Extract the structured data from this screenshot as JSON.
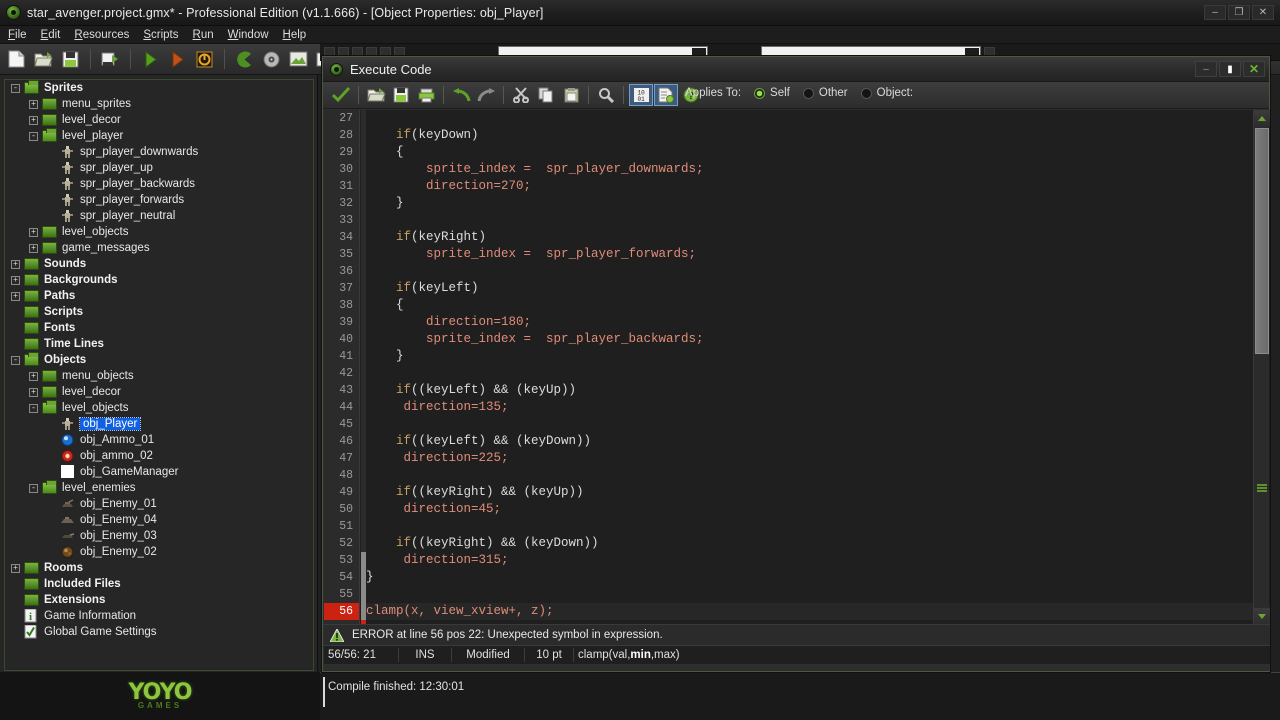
{
  "window": {
    "title": "star_avenger.project.gmx*  -  Professional Edition (v1.1.666) - [Object Properties: obj_Player]",
    "app_minimize": "–",
    "app_maximize": "❐",
    "app_close": "✕",
    "mdi_minimize": "–",
    "mdi_restore": "❐",
    "mdi_close": "✕"
  },
  "menubar": {
    "items": [
      {
        "label": "File"
      },
      {
        "label": "Edit"
      },
      {
        "label": "Resources"
      },
      {
        "label": "Scripts"
      },
      {
        "label": "Run"
      },
      {
        "label": "Window"
      },
      {
        "label": "Help"
      }
    ]
  },
  "main_toolbar": {
    "buttons": [
      {
        "name": "new-project-button",
        "icon": "new-file-icon"
      },
      {
        "name": "open-project-button",
        "icon": "open-folder-icon"
      },
      {
        "name": "save-project-button",
        "icon": "save-disk-icon"
      },
      {
        "name": "create-executable-button",
        "icon": "export-exe-icon"
      },
      {
        "name": "run-normally-button",
        "icon": "play-green-icon"
      },
      {
        "name": "run-debug-button",
        "icon": "play-orange-icon"
      },
      {
        "name": "stop-button",
        "icon": "stop-icon"
      },
      {
        "name": "create-sprite-button",
        "icon": "pacman-sprite-icon"
      },
      {
        "name": "create-sound-button",
        "icon": "sound-disc-icon"
      },
      {
        "name": "create-background-button",
        "icon": "background-image-icon"
      },
      {
        "name": "create-path-button",
        "icon": "path-arrow-icon"
      },
      {
        "name": "create-script-button",
        "icon": "script-page-icon"
      },
      {
        "name": "create-font-button",
        "icon": "font-icon"
      },
      {
        "name": "create-object-button",
        "icon": "object-ball-icon"
      }
    ]
  },
  "tree": {
    "items": [
      {
        "depth": 0,
        "expander": "-",
        "icon": "folder-open",
        "label": "Sprites",
        "bold": true,
        "selected": false
      },
      {
        "depth": 1,
        "expander": "+",
        "icon": "folder",
        "label": "menu_sprites",
        "bold": false,
        "selected": false
      },
      {
        "depth": 1,
        "expander": "+",
        "icon": "folder",
        "label": "level_decor",
        "bold": false,
        "selected": false
      },
      {
        "depth": 1,
        "expander": "-",
        "icon": "folder-open",
        "label": "level_player",
        "bold": false,
        "selected": false
      },
      {
        "depth": 2,
        "expander": "",
        "icon": "sprite-player",
        "label": "spr_player_downwards",
        "bold": false,
        "selected": false
      },
      {
        "depth": 2,
        "expander": "",
        "icon": "sprite-player",
        "label": "spr_player_up",
        "bold": false,
        "selected": false
      },
      {
        "depth": 2,
        "expander": "",
        "icon": "sprite-player",
        "label": "spr_player_backwards",
        "bold": false,
        "selected": false
      },
      {
        "depth": 2,
        "expander": "",
        "icon": "sprite-player",
        "label": "spr_player_forwards",
        "bold": false,
        "selected": false
      },
      {
        "depth": 2,
        "expander": "",
        "icon": "sprite-player",
        "label": "spr_player_neutral",
        "bold": false,
        "selected": false
      },
      {
        "depth": 1,
        "expander": "+",
        "icon": "folder",
        "label": "level_objects",
        "bold": false,
        "selected": false
      },
      {
        "depth": 1,
        "expander": "+",
        "icon": "folder",
        "label": "game_messages",
        "bold": false,
        "selected": false
      },
      {
        "depth": 0,
        "expander": "+",
        "icon": "folder",
        "label": "Sounds",
        "bold": true,
        "selected": false
      },
      {
        "depth": 0,
        "expander": "+",
        "icon": "folder",
        "label": "Backgrounds",
        "bold": true,
        "selected": false
      },
      {
        "depth": 0,
        "expander": "+",
        "icon": "folder",
        "label": "Paths",
        "bold": true,
        "selected": false
      },
      {
        "depth": 0,
        "expander": "",
        "icon": "folder",
        "label": "Scripts",
        "bold": true,
        "selected": false
      },
      {
        "depth": 0,
        "expander": "",
        "icon": "folder",
        "label": "Fonts",
        "bold": true,
        "selected": false
      },
      {
        "depth": 0,
        "expander": "",
        "icon": "folder",
        "label": "Time Lines",
        "bold": true,
        "selected": false
      },
      {
        "depth": 0,
        "expander": "-",
        "icon": "folder-open",
        "label": "Objects",
        "bold": true,
        "selected": false
      },
      {
        "depth": 1,
        "expander": "+",
        "icon": "folder",
        "label": "menu_objects",
        "bold": false,
        "selected": false
      },
      {
        "depth": 1,
        "expander": "+",
        "icon": "folder",
        "label": "level_decor",
        "bold": false,
        "selected": false
      },
      {
        "depth": 1,
        "expander": "-",
        "icon": "folder-open",
        "label": "level_objects",
        "bold": false,
        "selected": false
      },
      {
        "depth": 2,
        "expander": "",
        "icon": "sprite-player",
        "label": "obj_Player",
        "bold": false,
        "selected": true
      },
      {
        "depth": 2,
        "expander": "",
        "icon": "ammo-blue",
        "label": "obj_Ammo_01",
        "bold": false,
        "selected": false
      },
      {
        "depth": 2,
        "expander": "",
        "icon": "ammo-red",
        "label": "obj_ammo_02",
        "bold": false,
        "selected": false
      },
      {
        "depth": 2,
        "expander": "",
        "icon": "blank-white",
        "label": "obj_GameManager",
        "bold": false,
        "selected": false
      },
      {
        "depth": 1,
        "expander": "-",
        "icon": "folder-open",
        "label": "level_enemies",
        "bold": false,
        "selected": false
      },
      {
        "depth": 2,
        "expander": "",
        "icon": "enemy-1",
        "label": "obj_Enemy_01",
        "bold": false,
        "selected": false
      },
      {
        "depth": 2,
        "expander": "",
        "icon": "enemy-4",
        "label": "obj_Enemy_04",
        "bold": false,
        "selected": false
      },
      {
        "depth": 2,
        "expander": "",
        "icon": "enemy-3",
        "label": "obj_Enemy_03",
        "bold": false,
        "selected": false
      },
      {
        "depth": 2,
        "expander": "",
        "icon": "enemy-2",
        "label": "obj_Enemy_02",
        "bold": false,
        "selected": false
      },
      {
        "depth": 0,
        "expander": "+",
        "icon": "folder",
        "label": "Rooms",
        "bold": true,
        "selected": false
      },
      {
        "depth": 0,
        "expander": "",
        "icon": "folder",
        "label": "Included Files",
        "bold": true,
        "selected": false
      },
      {
        "depth": 0,
        "expander": "",
        "icon": "folder",
        "label": "Extensions",
        "bold": true,
        "selected": false
      },
      {
        "depth": 0,
        "expander": "",
        "icon": "info",
        "label": "Game Information",
        "bold": false,
        "selected": false
      },
      {
        "depth": 0,
        "expander": "",
        "icon": "settings-check",
        "label": "Global Game Settings",
        "bold": false,
        "selected": false
      }
    ]
  },
  "code_window": {
    "title": "Execute Code",
    "toolbar": [
      {
        "name": "check-syntax-button",
        "icon": "green-check-icon"
      },
      {
        "name": "load-code-button",
        "icon": "open-folder-icon"
      },
      {
        "name": "save-code-button",
        "icon": "save-disk-icon"
      },
      {
        "name": "print-code-button",
        "icon": "printer-icon"
      },
      {
        "name": "undo-button",
        "icon": "undo-arrow-icon"
      },
      {
        "name": "redo-button",
        "icon": "redo-arrow-icon"
      },
      {
        "name": "cut-button",
        "icon": "scissors-icon"
      },
      {
        "name": "copy-button",
        "icon": "copy-pages-icon"
      },
      {
        "name": "paste-button",
        "icon": "clipboard-icon"
      },
      {
        "name": "find-button",
        "icon": "magnifier-icon"
      },
      {
        "name": "toggle-binary-button",
        "icon": "binary-code-icon"
      },
      {
        "name": "script-options-button",
        "icon": "script-page-icon"
      },
      {
        "name": "help-button",
        "icon": "question-help-icon"
      }
    ],
    "applies_to": {
      "label": "Applies To:",
      "options": [
        {
          "label": "Self",
          "selected": true
        },
        {
          "label": "Other",
          "selected": false
        },
        {
          "label": "Object:",
          "selected": false
        }
      ]
    },
    "lines": [
      {
        "n": 27,
        "tokens": [],
        "error": false
      },
      {
        "n": 28,
        "tokens": [
          {
            "t": "sp",
            "v": "    "
          },
          {
            "t": "kw",
            "v": "if"
          },
          {
            "t": "id",
            "v": "(keyDown)"
          }
        ],
        "error": false
      },
      {
        "n": 29,
        "tokens": [
          {
            "t": "sp",
            "v": "    "
          },
          {
            "t": "id",
            "v": "{"
          }
        ],
        "error": false
      },
      {
        "n": 30,
        "tokens": [
          {
            "t": "sp",
            "v": "        "
          },
          {
            "t": "var",
            "v": "sprite_index =  spr_player_downwards;"
          }
        ],
        "error": false
      },
      {
        "n": 31,
        "tokens": [
          {
            "t": "sp",
            "v": "        "
          },
          {
            "t": "var",
            "v": "direction=270;"
          }
        ],
        "error": false
      },
      {
        "n": 32,
        "tokens": [
          {
            "t": "sp",
            "v": "    "
          },
          {
            "t": "id",
            "v": "}"
          }
        ],
        "error": false
      },
      {
        "n": 33,
        "tokens": [],
        "error": false
      },
      {
        "n": 34,
        "tokens": [
          {
            "t": "sp",
            "v": "    "
          },
          {
            "t": "kw",
            "v": "if"
          },
          {
            "t": "id",
            "v": "(keyRight)"
          }
        ],
        "error": false
      },
      {
        "n": 35,
        "tokens": [
          {
            "t": "sp",
            "v": "        "
          },
          {
            "t": "var",
            "v": "sprite_index =  spr_player_forwards;"
          }
        ],
        "error": false
      },
      {
        "n": 36,
        "tokens": [],
        "error": false
      },
      {
        "n": 37,
        "tokens": [
          {
            "t": "sp",
            "v": "    "
          },
          {
            "t": "kw",
            "v": "if"
          },
          {
            "t": "id",
            "v": "(keyLeft)"
          }
        ],
        "error": false
      },
      {
        "n": 38,
        "tokens": [
          {
            "t": "sp",
            "v": "    "
          },
          {
            "t": "id",
            "v": "{"
          }
        ],
        "error": false
      },
      {
        "n": 39,
        "tokens": [
          {
            "t": "sp",
            "v": "        "
          },
          {
            "t": "var",
            "v": "direction=180;"
          }
        ],
        "error": false
      },
      {
        "n": 40,
        "tokens": [
          {
            "t": "sp",
            "v": "        "
          },
          {
            "t": "var",
            "v": "sprite_index =  spr_player_backwards;"
          }
        ],
        "error": false
      },
      {
        "n": 41,
        "tokens": [
          {
            "t": "sp",
            "v": "    "
          },
          {
            "t": "id",
            "v": "}"
          }
        ],
        "error": false
      },
      {
        "n": 42,
        "tokens": [],
        "error": false
      },
      {
        "n": 43,
        "tokens": [
          {
            "t": "sp",
            "v": "    "
          },
          {
            "t": "kw",
            "v": "if"
          },
          {
            "t": "id",
            "v": "((keyLeft) && (keyUp))"
          }
        ],
        "error": false
      },
      {
        "n": 44,
        "tokens": [
          {
            "t": "sp",
            "v": "     "
          },
          {
            "t": "var",
            "v": "direction=135;"
          }
        ],
        "error": false
      },
      {
        "n": 45,
        "tokens": [],
        "error": false
      },
      {
        "n": 46,
        "tokens": [
          {
            "t": "sp",
            "v": "    "
          },
          {
            "t": "kw",
            "v": "if"
          },
          {
            "t": "id",
            "v": "((keyLeft) && (keyDown))"
          }
        ],
        "error": false
      },
      {
        "n": 47,
        "tokens": [
          {
            "t": "sp",
            "v": "     "
          },
          {
            "t": "var",
            "v": "direction=225;"
          }
        ],
        "error": false
      },
      {
        "n": 48,
        "tokens": [],
        "error": false
      },
      {
        "n": 49,
        "tokens": [
          {
            "t": "sp",
            "v": "    "
          },
          {
            "t": "kw",
            "v": "if"
          },
          {
            "t": "id",
            "v": "((keyRight) && (keyUp))"
          }
        ],
        "error": false
      },
      {
        "n": 50,
        "tokens": [
          {
            "t": "sp",
            "v": "     "
          },
          {
            "t": "var",
            "v": "direction=45;"
          }
        ],
        "error": false
      },
      {
        "n": 51,
        "tokens": [],
        "error": false
      },
      {
        "n": 52,
        "tokens": [
          {
            "t": "sp",
            "v": "    "
          },
          {
            "t": "kw",
            "v": "if"
          },
          {
            "t": "id",
            "v": "((keyRight) && (keyDown))"
          }
        ],
        "error": false
      },
      {
        "n": 53,
        "tokens": [
          {
            "t": "sp",
            "v": "     "
          },
          {
            "t": "var",
            "v": "direction=315;"
          }
        ],
        "error": false
      },
      {
        "n": 54,
        "tokens": [
          {
            "t": "id",
            "v": "}"
          }
        ],
        "error": false
      },
      {
        "n": 55,
        "tokens": [],
        "error": false
      },
      {
        "n": 56,
        "tokens": [
          {
            "t": "fn",
            "v": "clamp(x, view_xview+, z);"
          }
        ],
        "error": true
      }
    ],
    "error_message": "ERROR at line 56 pos 22: Unexpected symbol in expression.",
    "status": {
      "position": "56/56:  21",
      "insert_mode": "INS",
      "modified": "Modified",
      "font_size": "10 pt",
      "hint_prefix": "clamp(val,",
      "hint_bold": "min",
      "hint_suffix": ",max)"
    }
  },
  "output": {
    "text": "Compile finished: 12:30:01"
  },
  "logo": {
    "line1": "YOYO",
    "line2": "GAMES"
  },
  "colors": {
    "accent_green": "#6aa33a",
    "selection_blue": "#1060e0",
    "error_red": "#cc2211",
    "keyword": "#c9a063",
    "variable": "#e08c78"
  }
}
